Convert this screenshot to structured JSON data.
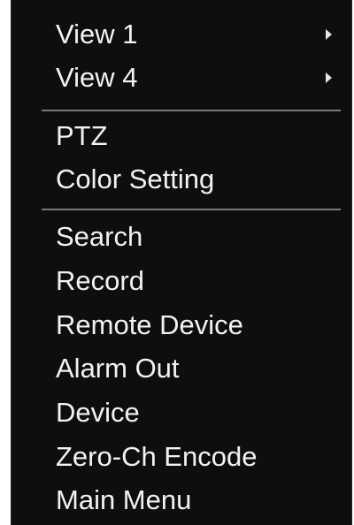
{
  "menu": {
    "items": [
      {
        "label": "View 1",
        "has_submenu": true
      },
      {
        "label": "View 4",
        "has_submenu": true
      },
      {
        "label": "PTZ",
        "has_submenu": false
      },
      {
        "label": "Color Setting",
        "has_submenu": false
      },
      {
        "label": "Search",
        "has_submenu": false
      },
      {
        "label": "Record",
        "has_submenu": false
      },
      {
        "label": "Remote Device",
        "has_submenu": false
      },
      {
        "label": "Alarm Out",
        "has_submenu": false
      },
      {
        "label": "Device",
        "has_submenu": false
      },
      {
        "label": "Zero-Ch Encode",
        "has_submenu": false
      },
      {
        "label": "Main Menu",
        "has_submenu": false
      }
    ]
  },
  "colors": {
    "background": "#0e0e0e",
    "text": "#f2f2f2",
    "separator": "#7a7a7a"
  }
}
